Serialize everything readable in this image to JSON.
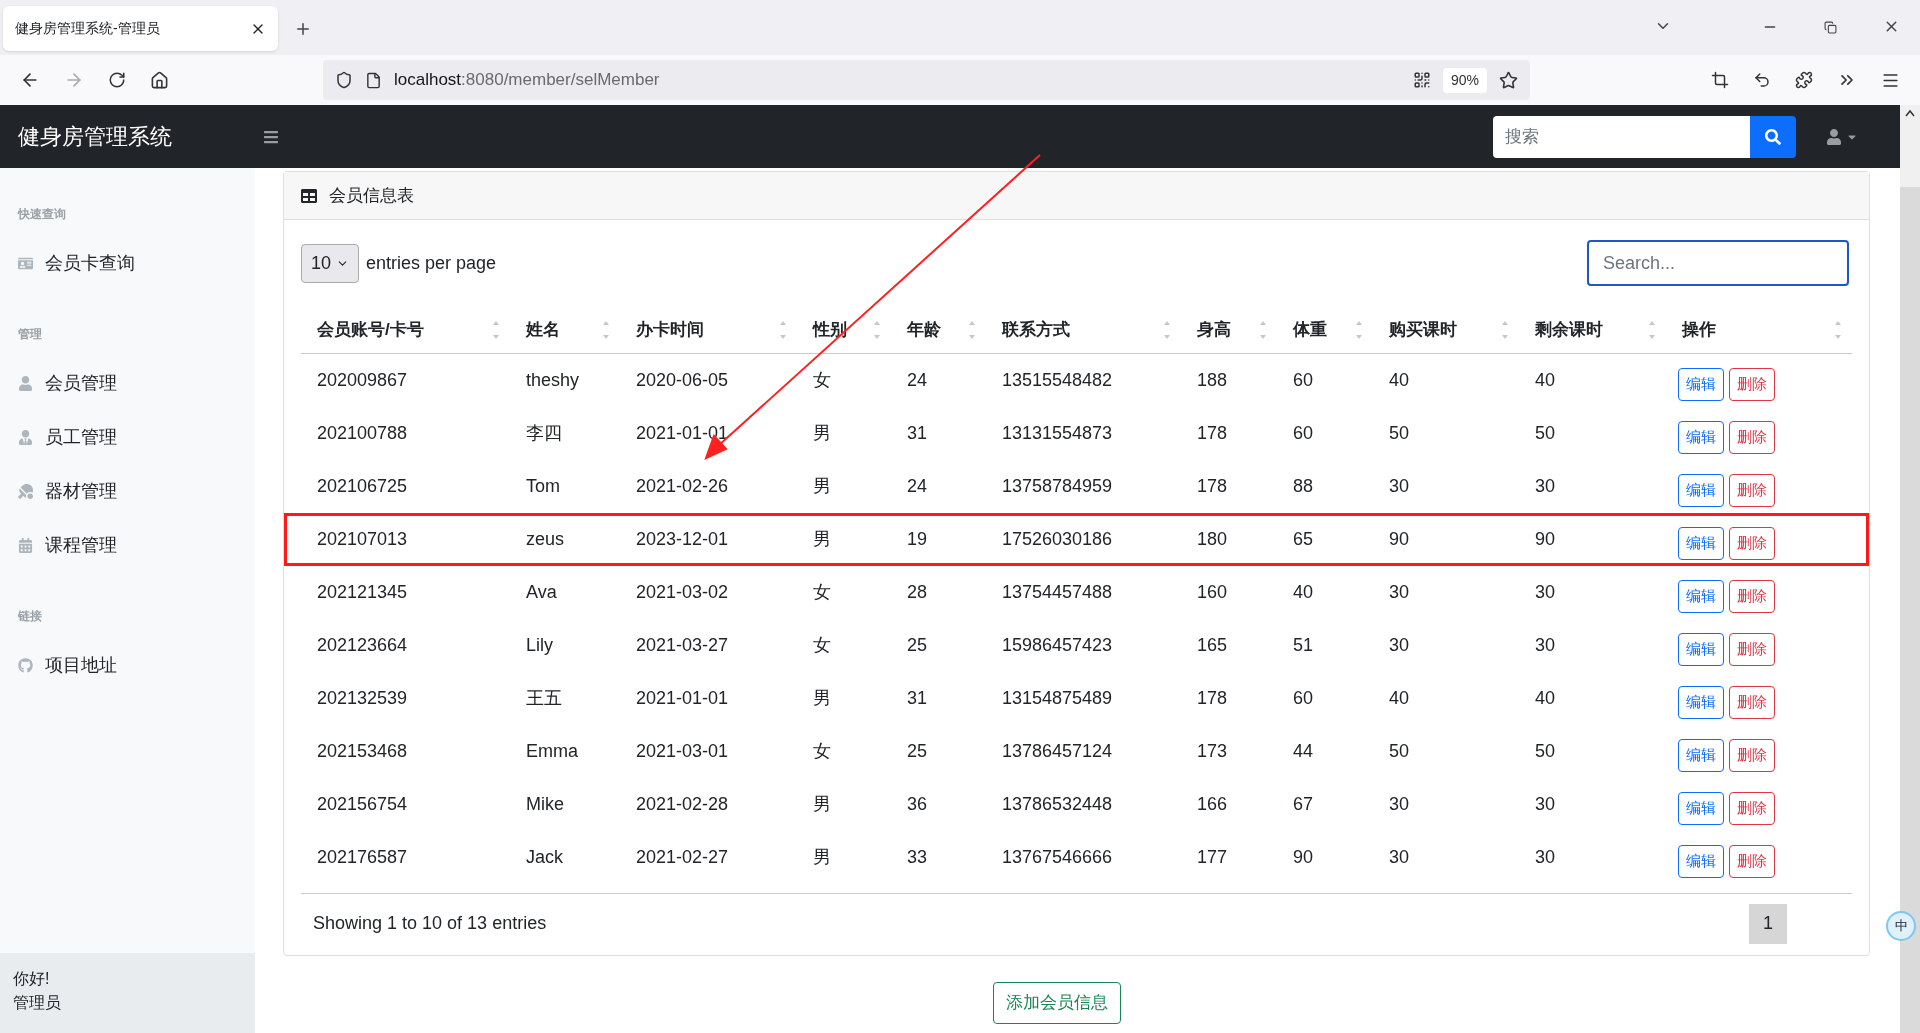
{
  "browser": {
    "tab_title": "健身房管理系统-管理员",
    "url_host": "localhost",
    "url_path": ":8080/member/selMember",
    "zoom": "90%"
  },
  "navbar": {
    "brand": "健身房管理系统",
    "search_placeholder": "搜索"
  },
  "sidebar": {
    "sections": [
      {
        "heading": "快速查询",
        "items": [
          {
            "label": "会员卡查询"
          }
        ]
      },
      {
        "heading": "管理",
        "items": [
          {
            "label": "会员管理"
          },
          {
            "label": "员工管理"
          },
          {
            "label": "器材管理"
          },
          {
            "label": "课程管理"
          }
        ]
      },
      {
        "heading": "链接",
        "items": [
          {
            "label": "项目地址"
          }
        ]
      }
    ],
    "footer": {
      "greeting": "你好!",
      "role": "管理员"
    }
  },
  "card": {
    "title": "会员信息表",
    "page_length": "10",
    "length_label": "entries per page",
    "search_placeholder": "Search...",
    "columns": [
      "会员账号/卡号",
      "姓名",
      "办卡时间",
      "性别",
      "年龄",
      "联系方式",
      "身高",
      "体重",
      "购买课时",
      "剩余课时",
      "操作"
    ],
    "rows": [
      {
        "cells": [
          "202009867",
          "theshy",
          "2020-06-05",
          "女",
          "24",
          "13515548482",
          "188",
          "60",
          "40",
          "40"
        ],
        "actions": [
          "编辑",
          "删除"
        ],
        "highlighted": false
      },
      {
        "cells": [
          "202100788",
          "李四",
          "2021-01-01",
          "男",
          "31",
          "13131554873",
          "178",
          "60",
          "50",
          "50"
        ],
        "actions": [
          "编辑",
          "删除"
        ],
        "highlighted": false
      },
      {
        "cells": [
          "202106725",
          "Tom",
          "2021-02-26",
          "男",
          "24",
          "13758784959",
          "178",
          "88",
          "30",
          "30"
        ],
        "actions": [
          "编辑",
          "删除"
        ],
        "highlighted": false
      },
      {
        "cells": [
          "202107013",
          "zeus",
          "2023-12-01",
          "男",
          "19",
          "17526030186",
          "180",
          "65",
          "90",
          "90"
        ],
        "actions": [
          "编辑",
          "删除"
        ],
        "highlighted": true
      },
      {
        "cells": [
          "202121345",
          "Ava",
          "2021-03-02",
          "女",
          "28",
          "13754457488",
          "160",
          "40",
          "30",
          "30"
        ],
        "actions": [
          "编辑",
          "删除"
        ],
        "highlighted": false
      },
      {
        "cells": [
          "202123664",
          "Lily",
          "2021-03-27",
          "女",
          "25",
          "15986457423",
          "165",
          "51",
          "30",
          "30"
        ],
        "actions": [
          "编辑",
          "删除"
        ],
        "highlighted": false
      },
      {
        "cells": [
          "202132539",
          "王五",
          "2021-01-01",
          "男",
          "31",
          "13154875489",
          "178",
          "60",
          "40",
          "40"
        ],
        "actions": [
          "编辑",
          "删除"
        ],
        "highlighted": false
      },
      {
        "cells": [
          "202153468",
          "Emma",
          "2021-03-01",
          "女",
          "25",
          "13786457124",
          "173",
          "44",
          "50",
          "50"
        ],
        "actions": [
          "编辑",
          "删除"
        ],
        "highlighted": false
      },
      {
        "cells": [
          "202156754",
          "Mike",
          "2021-02-28",
          "男",
          "36",
          "13786532448",
          "166",
          "67",
          "30",
          "30"
        ],
        "actions": [
          "编辑",
          "删除"
        ],
        "highlighted": false
      },
      {
        "cells": [
          "202176587",
          "Jack",
          "2021-02-27",
          "男",
          "33",
          "13767546666",
          "177",
          "90",
          "30",
          "30"
        ],
        "actions": [
          "编辑",
          "删除"
        ],
        "highlighted": false
      }
    ],
    "info": "Showing 1 to 10 of 13 entries",
    "pages": [
      {
        "label": "1",
        "selected": true
      }
    ]
  },
  "add_button": "添加会员信息",
  "annotation_arrow": true,
  "widget_button": "中"
}
